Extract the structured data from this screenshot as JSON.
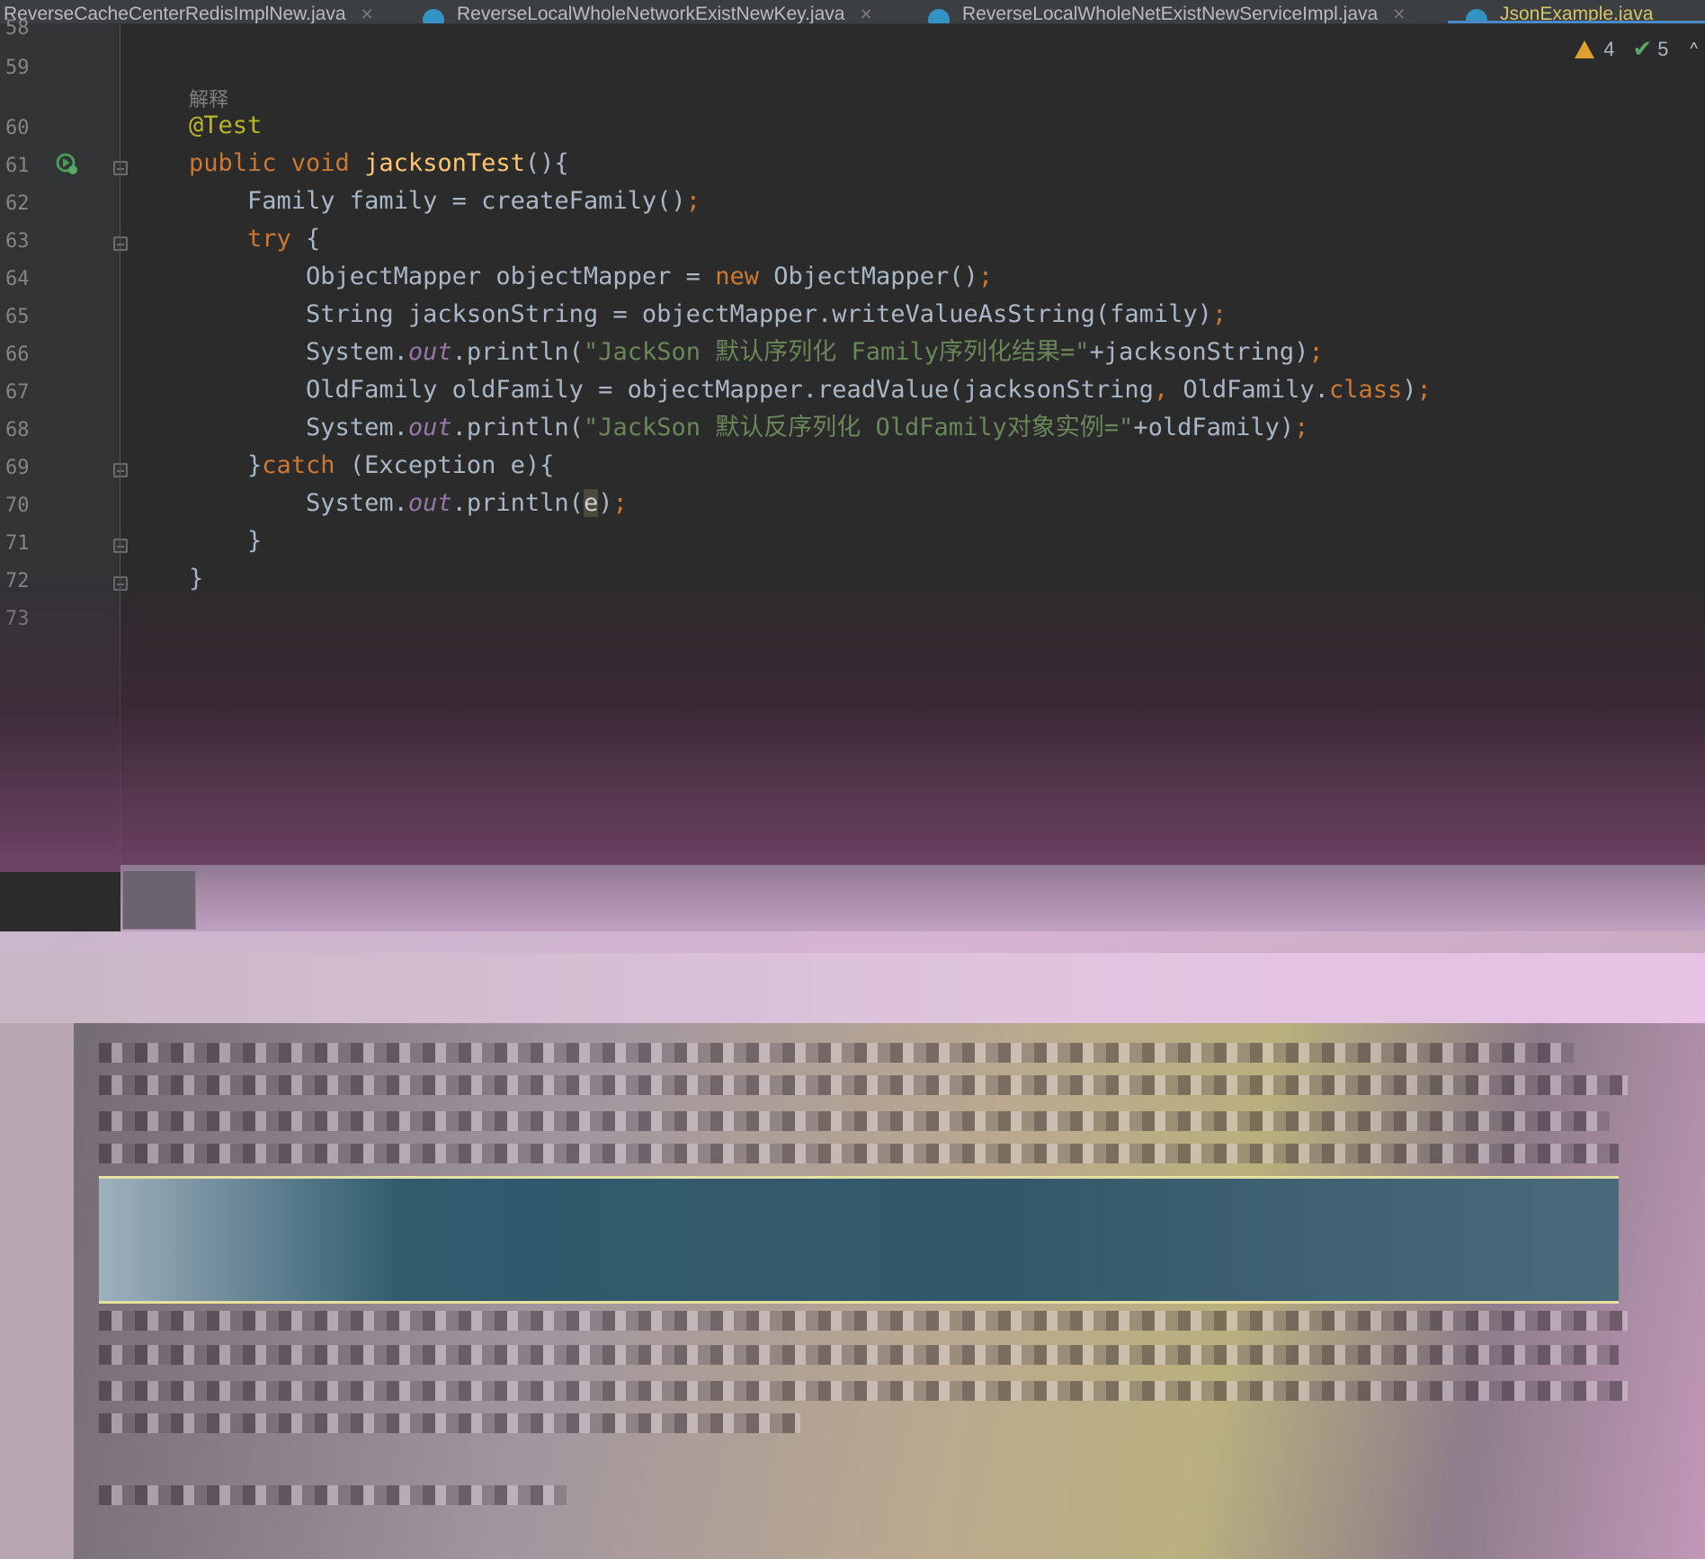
{
  "tabs": [
    {
      "label": "ReverseCacheCenterRedisImplNew.java",
      "active": false
    },
    {
      "label": "ReverseLocalWholeNetworkExistNewKey.java",
      "active": false
    },
    {
      "label": "ReverseLocalWholeNetExistNewServiceImpl.java",
      "active": false
    },
    {
      "label": "JsonExample.java",
      "active": true
    }
  ],
  "editor": {
    "line_numbers": [
      "58",
      "59",
      "60",
      "61",
      "62",
      "63",
      "64",
      "65",
      "66",
      "67",
      "68",
      "69",
      "70",
      "71",
      "72",
      "73"
    ],
    "doc_comment": "解释",
    "inspections": {
      "warnings": "4",
      "ok": "5"
    },
    "code": {
      "l60": "@Test",
      "l61_kw": "public void ",
      "l61_fn": "jacksonTest",
      "l61_rest": "(){",
      "l62_a": "    Family family = createFamily()",
      "l62_semi": ";",
      "l63_kw": "    try",
      "l63_rest": " {",
      "l64_a": "        ObjectMapper objectMapper = ",
      "l64_kw": "new",
      "l64_b": " ObjectMapper()",
      "l64_semi": ";",
      "l65_a": "        String jacksonString = objectMapper.writeValueAsString(family)",
      "l65_semi": ";",
      "l66_a": "        System.",
      "l66_fld": "out",
      "l66_b": ".println(",
      "l66_str": "\"JackSon 默认序列化 Family序列化结果=\"",
      "l66_c": "+jacksonString)",
      "l66_semi": ";",
      "l67_a": "        OldFamily oldFamily = objectMapper.readValue(jacksonString",
      "l67_comma": ",",
      "l67_b": " OldFamily.",
      "l67_kw": "class",
      "l67_c": ")",
      "l67_semi": ";",
      "l68_a": "        System.",
      "l68_fld": "out",
      "l68_b": ".println(",
      "l68_str": "\"JackSon 默认反序列化 OldFamily对象实例=\"",
      "l68_c": "+oldFamily)",
      "l68_semi": ";",
      "l69_a": "    }",
      "l69_kw": "catch",
      "l69_b": " (Exception e){",
      "l70_a": "        System.",
      "l70_fld": "out",
      "l70_b": ".println(",
      "l70_caret": "e",
      "l70_c": ")",
      "l70_semi": ";",
      "l71": "    }",
      "l72": "}"
    }
  },
  "colors": {
    "keyword": "#cc7832",
    "annotation": "#bbb529",
    "method": "#ffc66d",
    "string": "#6a8759",
    "static_field": "#9876aa",
    "accent": "#4a88c7"
  }
}
